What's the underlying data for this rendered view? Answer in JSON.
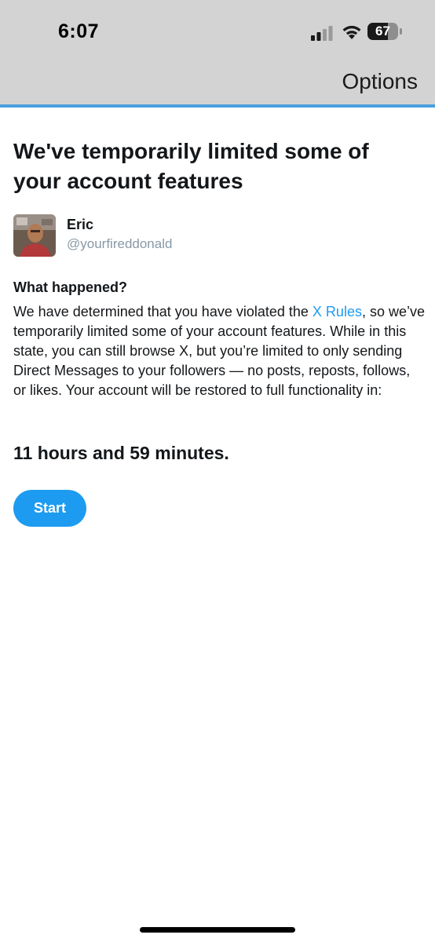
{
  "status_bar": {
    "time": "6:07",
    "battery_level": "67",
    "signal_icon": "cellular-signal-icon",
    "wifi_icon": "wifi-icon",
    "battery_icon": "battery-icon"
  },
  "nav": {
    "options_label": "Options"
  },
  "notice": {
    "title": "We've temporarily limited some of your account features",
    "user": {
      "name": "Eric",
      "handle": "@yourfireddonald"
    },
    "section_heading": "What happened?",
    "body_before_link": "We have determined that you have violated the ",
    "link_text": "X Rules",
    "body_after_link": ", so we’ve temporarily limited some of your account features. While in this state, you can still browse X, but you’re limited to only sending Direct Messages to your followers — no posts, reposts, follows, or likes. Your account will be restored to full functionality in:",
    "countdown": "11 hours and 59 minutes.",
    "start_label": "Start"
  },
  "colors": {
    "accent": "#1d9bf0",
    "header_bg": "#d3d3d3",
    "header_border": "#4aa0df",
    "text": "#14171a",
    "handle": "#8899a6"
  }
}
